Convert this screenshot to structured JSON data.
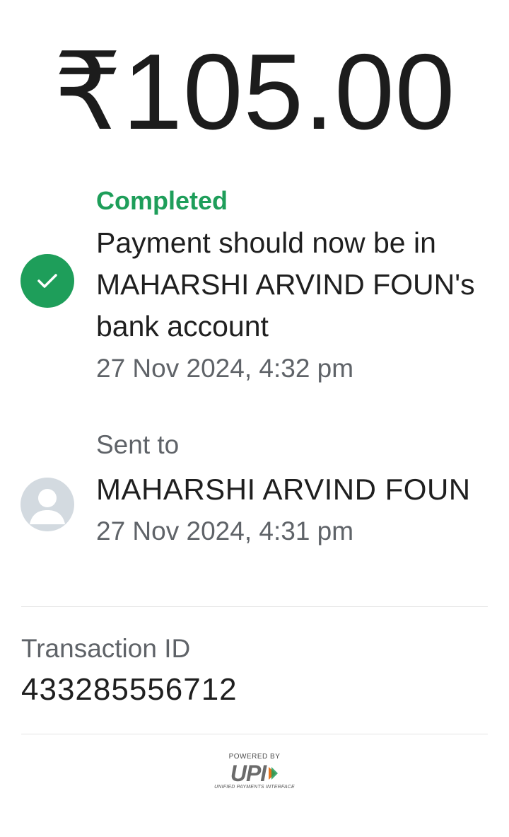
{
  "payment": {
    "amount": "₹105.00"
  },
  "status": {
    "label": "Completed",
    "message": "Payment should now be in MAHARSHI ARVIND FOUN's bank account",
    "timestamp": "27 Nov 2024, 4:32 pm",
    "color": "#1e9e5a",
    "icon": "check-icon"
  },
  "recipient": {
    "label": "Sent to",
    "name": "MAHARSHI ARVIND FOUN",
    "timestamp": "27 Nov 2024, 4:31 pm",
    "icon": "avatar-placeholder-icon"
  },
  "transaction": {
    "label": "Transaction ID",
    "id": "433285556712"
  },
  "footer": {
    "powered_by": "POWERED BY",
    "brand": "UPI",
    "brand_subtitle": "UNIFIED PAYMENTS INTERFACE"
  }
}
